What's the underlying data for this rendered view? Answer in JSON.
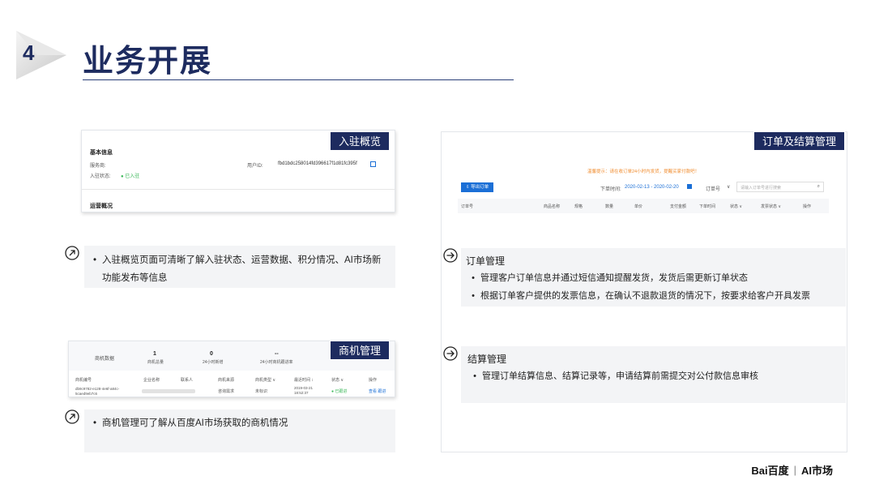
{
  "header": {
    "number": "4",
    "title": "业务开展"
  },
  "panel_entry": {
    "tag": "入驻概览",
    "basic_info": "基本信息",
    "provider_label": "服务商:",
    "status_label": "入驻状态:",
    "status_value": "● 已入驻",
    "user_id_label": "用户ID:",
    "user_id_value": "fbd1bdc258014fd396617f1d81fc395f",
    "ops_overview": "运营概况",
    "bullet": "入驻概览页面可清晰了解入驻状态、运营数据、积分情况、AI市场新功能发布等信息"
  },
  "panel_opportunity": {
    "tag": "商机管理",
    "stats_label": "商机数据",
    "stats": [
      {
        "value": "1",
        "label": "商机总量"
      },
      {
        "value": "0",
        "label": "24小时新增"
      },
      {
        "value": "--",
        "label": "24小时商机跟进率"
      }
    ],
    "columns": [
      "商机编号",
      "企业名称",
      "联系人",
      "商机来源",
      "商机类型 ∨",
      "最近时间 ↕",
      "状态 ∨",
      "操作"
    ],
    "row": {
      "id": "db9c9782-e128-4e6f-a84c-5caed9eb7c6",
      "source": "咨询需求",
      "type": "未标识",
      "time": "2019-03-21 18:52:37",
      "status": "● 已跟进",
      "actions": "查看 跟进"
    },
    "bullet": "商机管理可了解从百度AI市场获取的商机情况"
  },
  "panel_order": {
    "tag": "订单及结算管理",
    "notice": "温馨提示：请在收订单24小时内发货，提醒买家付款吧！",
    "export_button": "导出订单",
    "date_label": "下单时间:",
    "date_range": "2020-02-13 - 2020-02-20",
    "order_no_select": "订单号",
    "search_placeholder": "请输入订单号进行搜索",
    "columns": [
      "订单号",
      "商品名称",
      "规格",
      "数量",
      "单价",
      "支付金额",
      "下单时间",
      "状态 ∨",
      "发票状态 ∨",
      "操作"
    ],
    "order_box": {
      "heading": "订单管理",
      "bullets": [
        "管理客户订单信息并通过短信通知提醒发货，发货后需更新订单状态",
        "根据订单客户提供的发票信息，在确认不退款退货的情况下，按要求给客户开具发票"
      ]
    },
    "settle_box": {
      "heading": "结算管理",
      "bullets": [
        "管理订单结算信息、结算记录等，申请结算前需提交对公付款信息审核"
      ]
    }
  },
  "footer": {
    "brand": "Bai百度",
    "divider": "|",
    "market": "AI市场"
  },
  "colors": {
    "navy": "#1d2b5f",
    "accent_blue": "#1b6fd6",
    "green": "#3cb85a",
    "notice_orange": "#f08c2e"
  }
}
